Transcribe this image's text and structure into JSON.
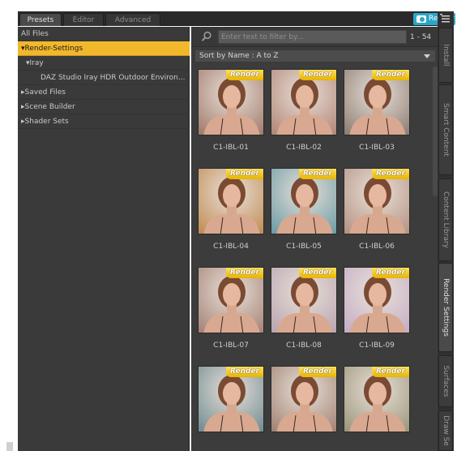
{
  "tabs": [
    {
      "label": "Presets",
      "active": true
    },
    {
      "label": "Editor",
      "active": false
    },
    {
      "label": "Advanced",
      "active": false
    }
  ],
  "render_button": {
    "label": "Render",
    "color": "#2aa6c8"
  },
  "tree": [
    {
      "label": "All Files",
      "prefix": "",
      "indent": 0,
      "selected": false
    },
    {
      "label": "Render-Settings",
      "prefix": "▾",
      "indent": 0,
      "selected": true
    },
    {
      "label": "Iray",
      "prefix": "▾",
      "indent": 1,
      "selected": false
    },
    {
      "label": "DAZ Studio Iray HDR Outdoor Environ...",
      "prefix": "",
      "indent": 2,
      "selected": false
    },
    {
      "label": "Saved Files",
      "prefix": "▸",
      "indent": 0,
      "selected": false
    },
    {
      "label": "Scene Builder",
      "prefix": "▸",
      "indent": 0,
      "selected": false
    },
    {
      "label": "Shader Sets",
      "prefix": "▸",
      "indent": 0,
      "selected": false
    }
  ],
  "filter": {
    "placeholder": "Enter text to filter by...",
    "value": "",
    "range": "1 - 54"
  },
  "sort": {
    "label": "Sort by Name : A to Z"
  },
  "badge_label": "Render",
  "items": [
    {
      "label": "C1-IBL-01",
      "tint": "#a07868"
    },
    {
      "label": "C1-IBL-02",
      "tint": "#b08474"
    },
    {
      "label": "C1-IBL-03",
      "tint": "#8a7a70"
    },
    {
      "label": "C1-IBL-04",
      "tint": "#c08a50"
    },
    {
      "label": "C1-IBL-05",
      "tint": "#6a9aa4"
    },
    {
      "label": "C1-IBL-06",
      "tint": "#b49080"
    },
    {
      "label": "C1-IBL-07",
      "tint": "#a48074"
    },
    {
      "label": "C1-IBL-08",
      "tint": "#b8a4b0"
    },
    {
      "label": "C1-IBL-09",
      "tint": "#c4acc4"
    },
    {
      "label": "",
      "tint": "#6e8a90"
    },
    {
      "label": "",
      "tint": "#a08070"
    },
    {
      "label": "",
      "tint": "#9a9478"
    }
  ],
  "side_tabs": [
    {
      "label": "Install",
      "active": false
    },
    {
      "label": "Smart Content",
      "active": false
    },
    {
      "label": "Content Library",
      "active": false
    },
    {
      "label": "Render Settings",
      "active": true
    },
    {
      "label": "Surfaces",
      "active": false
    },
    {
      "label": "Draw Se",
      "active": false
    }
  ],
  "colors": {
    "selected": "#f2b82c",
    "badge": "#f0c400",
    "panel": "#3a3a3a"
  }
}
